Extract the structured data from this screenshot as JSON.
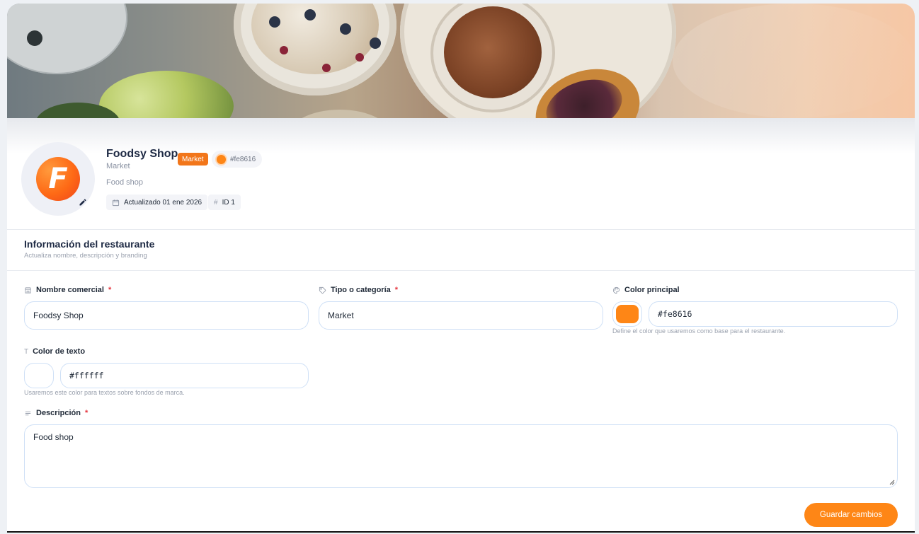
{
  "profile": {
    "name": "Foodsy Shop",
    "category_badge": "Market",
    "color_hex": "#fe8616",
    "category": "Market",
    "description": "Food shop",
    "avatar_letter": "F",
    "updated": "Actualizado 01 ene 2026",
    "id_label": "ID 1"
  },
  "section": {
    "title": "Información del restaurante",
    "subtitle": "Actualiza nombre, descripción y branding"
  },
  "form": {
    "name_label": "Nombre comercial",
    "name_value": "Foodsy Shop",
    "type_label": "Tipo o categoría",
    "type_value": "Market",
    "main_color_label": "Color principal",
    "main_color_value": "#fe8616",
    "main_color_hint": "Define el color que usaremos como base para el restaurante.",
    "text_color_label": "Color de texto",
    "text_color_value": "#ffffff",
    "text_color_hint": "Usaremos este color para textos sobre fondos de marca.",
    "description_label": "Descripción",
    "description_value": "Food shop",
    "required_mark": "*",
    "save_label": "Guardar cambios"
  },
  "colors": {
    "accent": "#fe8616",
    "badge": "#f2761a",
    "text_color_swatch": "#ffffff"
  },
  "icons": {
    "edit": "pencil-icon",
    "calendar": "calendar-icon",
    "hash": "#",
    "store": "store-icon",
    "tag": "tag-icon",
    "palette": "palette-icon",
    "text": "T",
    "lines": "lines-icon"
  }
}
